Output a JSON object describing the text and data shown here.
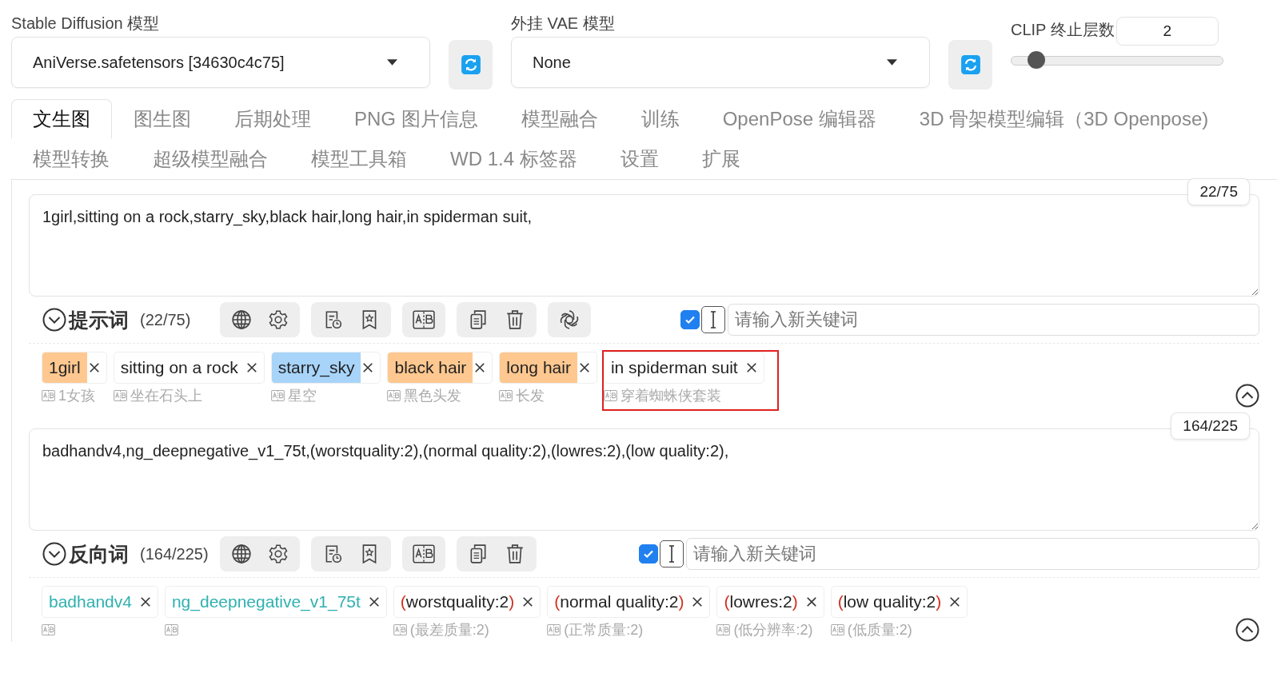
{
  "model": {
    "label": "Stable Diffusion 模型",
    "value": "AniVerse.safetensors [34630c4c75]"
  },
  "vae": {
    "label": "外挂 VAE 模型",
    "value": "None"
  },
  "clip": {
    "label": "CLIP 终止层数",
    "value": "2",
    "level": 0.09
  },
  "tabs": [
    {
      "label": "文生图",
      "selected": true
    },
    {
      "label": "图生图",
      "selected": false
    },
    {
      "label": "后期处理",
      "selected": false
    },
    {
      "label": "PNG 图片信息",
      "selected": false
    },
    {
      "label": "模型融合",
      "selected": false
    },
    {
      "label": "训练",
      "selected": false
    },
    {
      "label": "OpenPose 编辑器",
      "selected": false
    },
    {
      "label": "3D 骨架模型编辑（3D Openpose)",
      "selected": false
    },
    {
      "label": "模型转换",
      "selected": false
    },
    {
      "label": "超级模型融合",
      "selected": false
    },
    {
      "label": "模型工具箱",
      "selected": false
    },
    {
      "label": "WD 1.4 标签器",
      "selected": false
    },
    {
      "label": "设置",
      "selected": false
    },
    {
      "label": "扩展",
      "selected": false
    }
  ],
  "sections": [
    {
      "kind": "positive",
      "text": "1girl,sitting on a rock,starry_sky,black hair,long hair,in spiderman suit,",
      "counter": "22/75",
      "title": "提示词",
      "count": "(22/75)",
      "auto_checked": true,
      "placeholder": "请输入新关键词",
      "tags": [
        {
          "kind": "plain",
          "text": "1girl",
          "color": "#ffc890",
          "translation": "1女孩",
          "selected": false
        },
        {
          "kind": "plain",
          "text": "sitting on a rock",
          "translation": "坐在石头上",
          "selected": false
        },
        {
          "kind": "plain",
          "text": "starry_sky",
          "color": "#a8d4fa",
          "translation": "星空",
          "selected": false
        },
        {
          "kind": "plain",
          "text": "black hair",
          "color": "#ffc890",
          "translation": "黑色头发",
          "selected": false
        },
        {
          "kind": "plain",
          "text": "long hair",
          "color": "#ffc890",
          "translation": "长发",
          "selected": false
        },
        {
          "kind": "plain",
          "text": "in spiderman suit",
          "translation": "穿着蜘蛛侠套装",
          "selected": true
        }
      ]
    },
    {
      "kind": "negative",
      "text": "badhandv4,ng_deepnegative_v1_75t,(worstquality:2),(normal quality:2),(lowres:2),(low quality:2),",
      "counter": "164/225",
      "title": "反向词",
      "count": "(164/225)",
      "auto_checked": true,
      "placeholder": "请输入新关键词",
      "tags": [
        {
          "kind": "embedding",
          "text": "badhandv4",
          "selected": false
        },
        {
          "kind": "embedding",
          "text": "ng_deepnegative_v1_75t",
          "selected": false
        },
        {
          "kind": "weighted",
          "open": "(",
          "text": "worstquality:2",
          "close": ")",
          "translation": "(最差质量:2)",
          "selected": false
        },
        {
          "kind": "weighted",
          "open": "(",
          "text": "normal quality:2",
          "close": ")",
          "translation": "(正常质量:2)",
          "selected": false
        },
        {
          "kind": "weighted",
          "open": "(",
          "text": "lowres:2",
          "close": ")",
          "translation": "(低分辨率:2)",
          "selected": false
        },
        {
          "kind": "weighted",
          "open": "(",
          "text": "low quality:2",
          "close": ")",
          "translation": "(低质量:2)",
          "selected": false
        }
      ]
    }
  ]
}
